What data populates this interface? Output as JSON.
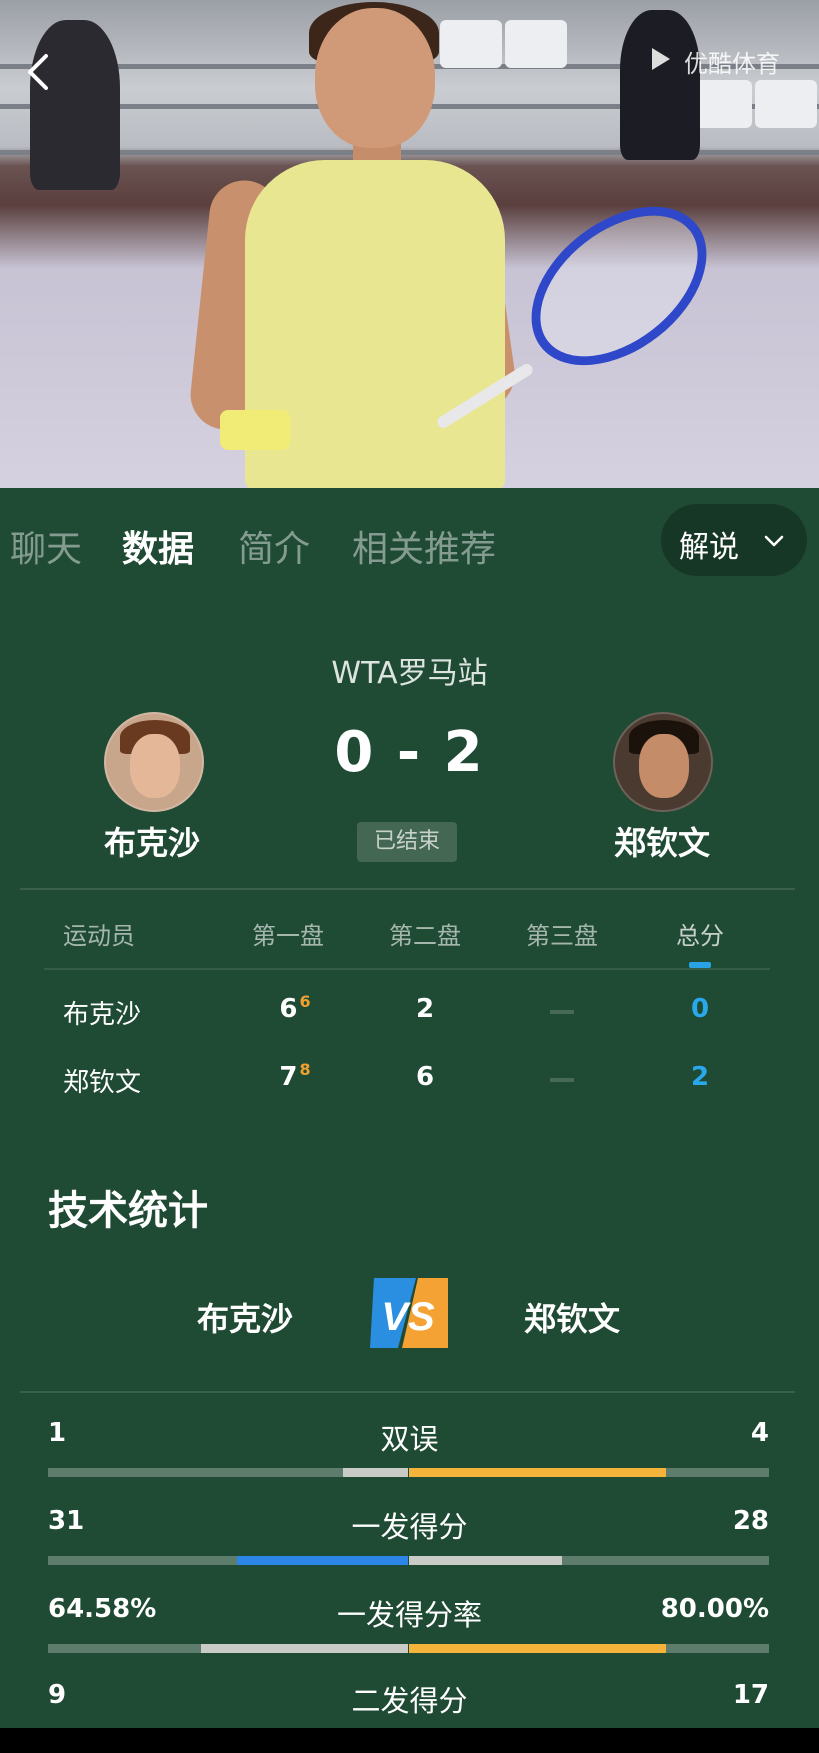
{
  "watermark": "优酷体育",
  "tabs": [
    {
      "label": "聊天"
    },
    {
      "label": "数据"
    },
    {
      "label": "简介"
    },
    {
      "label": "相关推荐"
    }
  ],
  "commentary_label": "解说",
  "event": "WTA罗马站",
  "score": "0 - 2",
  "status": "已结束",
  "players": {
    "left": "布克沙",
    "right": "郑钦文"
  },
  "table": {
    "headers": [
      "运动员",
      "第一盘",
      "第二盘",
      "第三盘",
      "总分"
    ],
    "rows": [
      {
        "name": "布克沙",
        "set1": "6",
        "set1_tb": "6",
        "set2": "2",
        "total": "0"
      },
      {
        "name": "郑钦文",
        "set1": "7",
        "set1_tb": "8",
        "set2": "6",
        "total": "2"
      }
    ]
  },
  "stats_title": "技术统计",
  "vs_label": "VS",
  "stats": [
    {
      "label": "双误",
      "left": "1",
      "right": "4",
      "left_fraction": 0.18,
      "right_fraction": 0.715,
      "left_color": "#c9cbc7",
      "right_color": "#f4b43c"
    },
    {
      "label": "一发得分",
      "left": "31",
      "right": "28",
      "left_fraction": 0.475,
      "right_fraction": 0.425,
      "left_color": "#2b86e8",
      "right_color": "#c9cbc7"
    },
    {
      "label": "一发得分率",
      "left": "64.58%",
      "right": "80.00%",
      "left_fraction": 0.575,
      "right_fraction": 0.715,
      "left_color": "#c9cbc7",
      "right_color": "#f4b43c"
    },
    {
      "label": "二发得分",
      "left": "9",
      "right": "17"
    }
  ],
  "colors": {
    "accent_blue": "#29a3e6",
    "accent_orange": "#f4b43c",
    "tiebreak": "#f0a030",
    "background": "#1f4a33"
  }
}
